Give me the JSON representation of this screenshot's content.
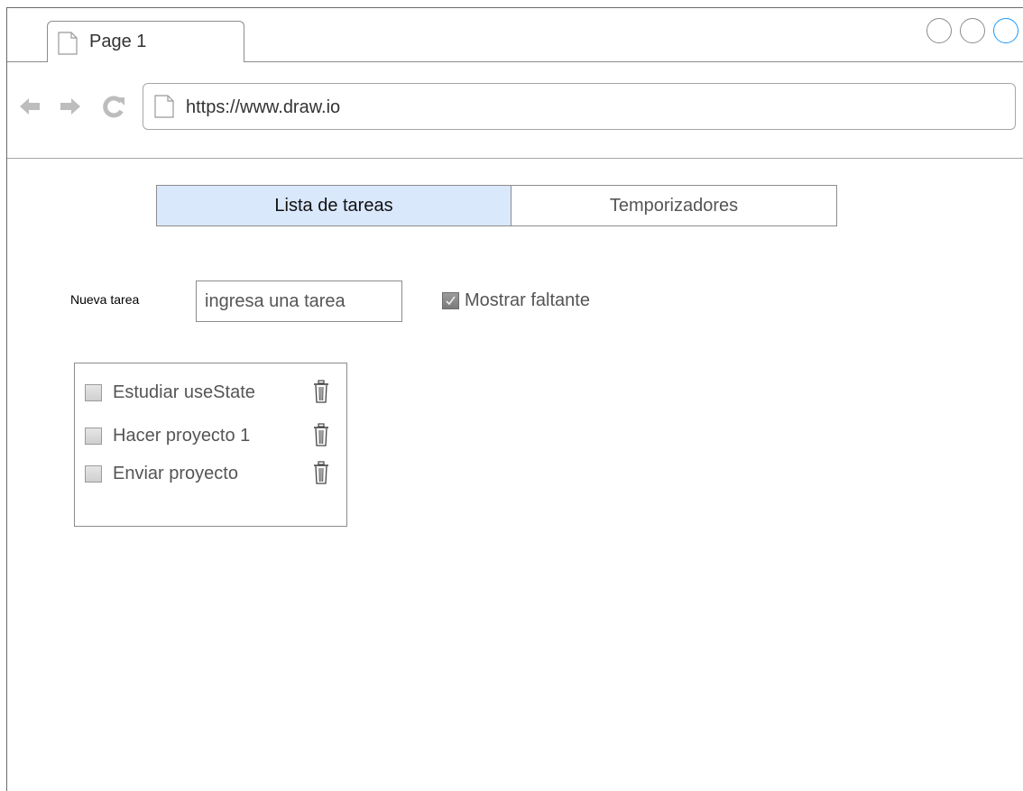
{
  "browser": {
    "tab_label": "Page 1",
    "url": "https://www.draw.io"
  },
  "app": {
    "tabs": [
      {
        "label": "Lista de tareas",
        "active": true
      },
      {
        "label": "Temporizadores",
        "active": false
      }
    ],
    "new_task": {
      "label": "Nueva tarea",
      "placeholder": "ingresa una tarea"
    },
    "show_pending": {
      "label": "Mostrar faltante",
      "checked": true
    },
    "tasks": [
      {
        "text": "Estudiar useState",
        "done": false
      },
      {
        "text": "Hacer proyecto 1",
        "done": false
      },
      {
        "text": "Enviar proyecto",
        "done": false
      }
    ]
  },
  "colors": {
    "active_tab_bg": "#dae8fc",
    "border": "#8c8c8c",
    "window_button_accent": "#1a9bff"
  }
}
